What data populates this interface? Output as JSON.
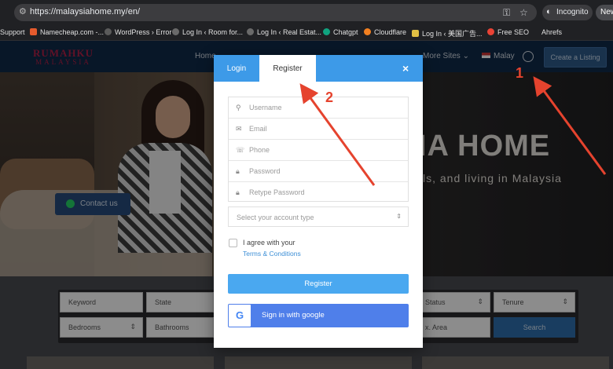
{
  "browser": {
    "url": "https://malaysiahome.my/en/",
    "incognito_label": "Incognito",
    "new_tab_label": "New",
    "bookmarks": [
      {
        "label": "Support",
        "color": ""
      },
      {
        "label": "Namecheap.com -...",
        "color": "#e65b2d"
      },
      {
        "label": "WordPress › Error",
        "color": "#5b5b5b"
      },
      {
        "label": "Log In ‹ Room for...",
        "color": "#6a6a6a"
      },
      {
        "label": "Log In ‹ Real Estat...",
        "color": "#6a6a6a"
      },
      {
        "label": "Chatgpt",
        "color": "#10a37f"
      },
      {
        "label": "Cloudflare",
        "color": "#f38020"
      },
      {
        "label": "Log In ‹ 美国广告...",
        "color": "#e2c044"
      },
      {
        "label": "Free SEO",
        "color": "#ea4335"
      },
      {
        "label": "Ahrefs",
        "color": ""
      }
    ]
  },
  "site": {
    "logo_line1": "RUMAHKU",
    "logo_line2": "MALAYSIA",
    "nav": [
      "Home",
      "More Sites",
      "Malay"
    ],
    "create_listing": "Create a Listing",
    "hero_title": "IA HOME",
    "hero_subtitle": "ls, and living in Malaysia",
    "contact_us": "Contact us"
  },
  "search": {
    "keyword": "Keyword",
    "state": "State",
    "status": "Status",
    "tenure": "Tenure",
    "bedrooms": "Bedrooms",
    "bathrooms": "Bathrooms",
    "max_area": "x. Area",
    "search_btn": "Search"
  },
  "modal": {
    "tab_login": "Login",
    "tab_register": "Register",
    "close": "×",
    "fields": {
      "username": "Username",
      "email": "Email",
      "phone": "Phone",
      "password": "Password",
      "retype_password": "Retype Password"
    },
    "account_type_placeholder": "Select your account type",
    "agree_text": "I agree with your",
    "terms_link": "Terms & Conditions",
    "register_btn": "Register",
    "google_letter": "G",
    "google_btn": "Sign in with google"
  },
  "annotations": [
    "1",
    "2"
  ],
  "colors": {
    "accent": "#3d9ae8",
    "annotation": "#e5432e",
    "nav_bg": "#0f2a4a"
  }
}
